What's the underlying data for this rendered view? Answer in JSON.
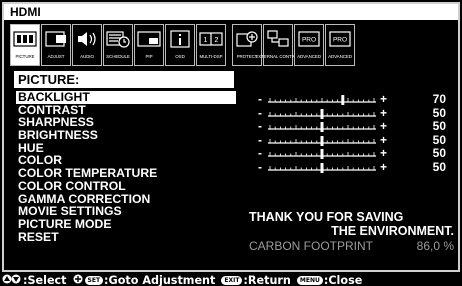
{
  "source": "HDMI",
  "tabs": [
    {
      "label": "PICTURE",
      "icon": "picture-icon",
      "active": true
    },
    {
      "label": "ADJUST",
      "icon": "adjust-icon"
    },
    {
      "label": "AUDIO",
      "icon": "audio-icon"
    },
    {
      "label": "SCHEDULE",
      "icon": "schedule-icon"
    },
    {
      "label": "PIP",
      "icon": "pip-icon"
    },
    {
      "label": "OSD",
      "icon": "osd-icon"
    },
    {
      "label": "MULTI-DSP",
      "icon": "multi-dsp-icon"
    },
    {
      "label": "PROTECT",
      "icon": "protect-icon"
    },
    {
      "label": "EXTERNAL CONTROL",
      "icon": "external-control-icon"
    },
    {
      "label": "ADVANCED",
      "icon": "pro-icon"
    },
    {
      "label": "ADVANCED",
      "icon": "pro-icon"
    }
  ],
  "category_title": "PICTURE:",
  "menu_items": [
    "BACKLIGHT",
    "CONTRAST",
    "SHARPNESS",
    "BRIGHTNESS",
    "HUE",
    "COLOR",
    "COLOR TEMPERATURE",
    "COLOR CONTROL",
    "GAMMA CORRECTION",
    "MOVIE SETTINGS",
    "PICTURE MODE",
    "RESET"
  ],
  "selected_index": 0,
  "sliders": [
    {
      "name": "BACKLIGHT",
      "value": "70",
      "level": 0.7
    },
    {
      "name": "CONTRAST",
      "value": "50",
      "level": 0.5
    },
    {
      "name": "SHARPNESS",
      "value": "50",
      "level": 0.5
    },
    {
      "name": "BRIGHTNESS",
      "value": "50",
      "level": 0.5
    },
    {
      "name": "HUE",
      "value": "50",
      "level": 0.5
    },
    {
      "name": "COLOR",
      "value": "50",
      "level": 0.5
    }
  ],
  "slider_minus": "-",
  "slider_plus": "+",
  "eco_line1": "THANK YOU FOR SAVING",
  "eco_line2": "THE ENVIRONMENT.",
  "carbon_label": "CARBON FOOTPRINT",
  "carbon_value": "86,0 %",
  "footer": {
    "select": ":Select",
    "set_key": "SET",
    "goto": ":Goto Adjustment",
    "exit_key": "EXIT",
    "return": ":Return",
    "menu_key": "MENU",
    "close": ":Close"
  }
}
